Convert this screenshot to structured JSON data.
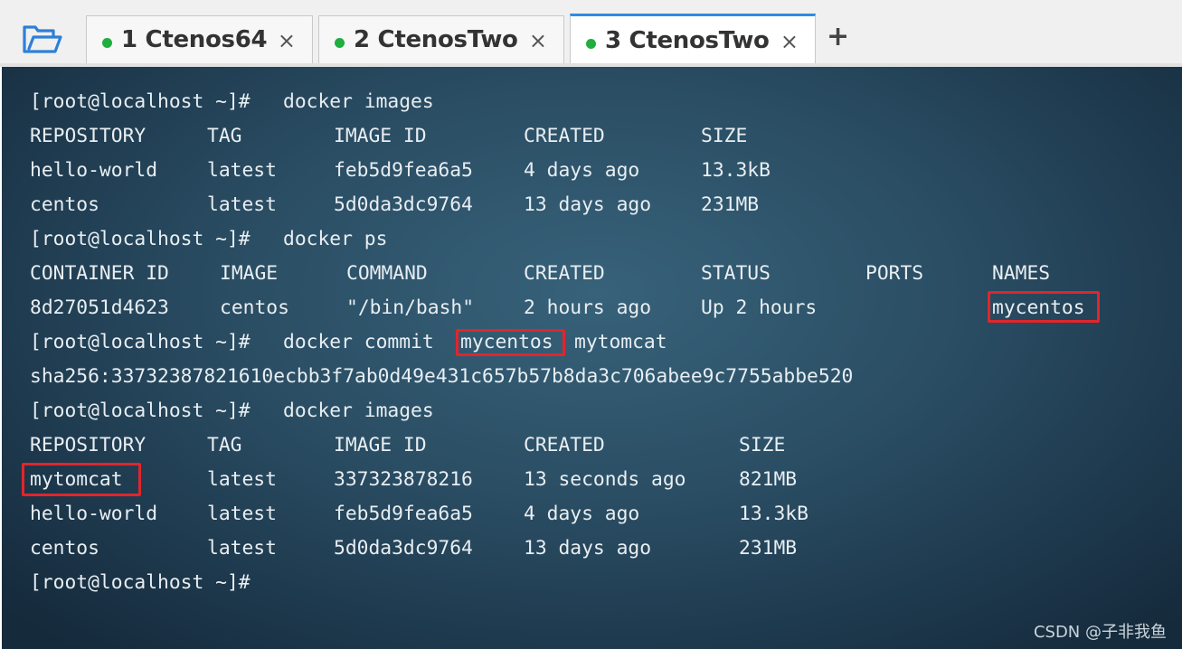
{
  "tabs": [
    {
      "label": "1 Ctenos64",
      "close": "×",
      "active": false
    },
    {
      "label": "2 CtenosTwo",
      "close": "×",
      "active": false
    },
    {
      "label": "3 CtenosTwo",
      "close": "×",
      "active": true
    }
  ],
  "add_tab_label": "+",
  "colors": {
    "accent": "#2d8ce6",
    "status_dot": "#1fae3f",
    "highlight": "#e2252b"
  },
  "terminal": {
    "prompt": "[root@localhost ~]#",
    "cmd1": "docker images",
    "images_header": [
      "REPOSITORY",
      "TAG",
      "IMAGE ID",
      "CREATED",
      "SIZE"
    ],
    "images_rows": [
      [
        "hello-world",
        "latest",
        "feb5d9fea6a5",
        "4 days ago",
        "13.3kB"
      ],
      [
        "centos",
        "latest",
        "5d0da3dc9764",
        "13 days ago",
        "231MB"
      ]
    ],
    "cmd2": "docker ps",
    "ps_header": [
      "CONTAINER ID",
      "IMAGE",
      "COMMAND",
      "CREATED",
      "STATUS",
      "PORTS",
      "NAMES"
    ],
    "ps_row": [
      "8d27051d4623",
      "centos",
      "\"/bin/bash\"",
      "2 hours ago",
      "Up 2 hours",
      "",
      "mycentos"
    ],
    "cmd3_prefix": "docker commit",
    "cmd3_container": "mycentos",
    "cmd3_image": "mytomcat",
    "sha_output": "sha256:33732387821610ecbb3f7ab0d49e431c657b57b8da3c706abee9c7755abbe520",
    "cmd4": "docker images",
    "images2_header": [
      "REPOSITORY",
      "TAG",
      "IMAGE ID",
      "CREATED",
      "SIZE"
    ],
    "images2_rows": [
      [
        "mytomcat",
        "latest",
        "337323878216",
        "13 seconds ago",
        "821MB"
      ],
      [
        "hello-world",
        "latest",
        "feb5d9fea6a5",
        "4 days ago",
        "13.3kB"
      ],
      [
        "centos",
        "latest",
        "5d0da3dc9764",
        "13 days ago",
        "231MB"
      ]
    ]
  },
  "watermark": "CSDN @子非我鱼"
}
